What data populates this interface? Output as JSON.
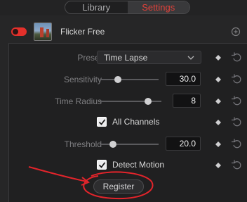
{
  "tabs": [
    {
      "label": "Library",
      "active": false
    },
    {
      "label": "Settings",
      "active": true
    }
  ],
  "effect": {
    "name": "Flicker Free",
    "enabled": true,
    "thumbnail_icon": "golden-gate-bridge-thumbnail"
  },
  "controls": {
    "preset": {
      "label": "Preset",
      "value": "Time Lapse"
    },
    "sensitivity": {
      "label": "Sensitivity",
      "value": "30.0",
      "level": 0.3
    },
    "time_radius": {
      "label": "Time Radius",
      "value": "8",
      "level": 0.8
    },
    "all_channels": {
      "label": "All Channels",
      "checked": true
    },
    "threshold": {
      "label": "Threshold",
      "value": "20.0",
      "level": 0.2
    },
    "detect_motion": {
      "label": "Detect Motion",
      "checked": true
    }
  },
  "register_button": {
    "label": "Register"
  },
  "colors": {
    "accent_red": "#e0413a",
    "annotation_red": "#e3242b"
  }
}
